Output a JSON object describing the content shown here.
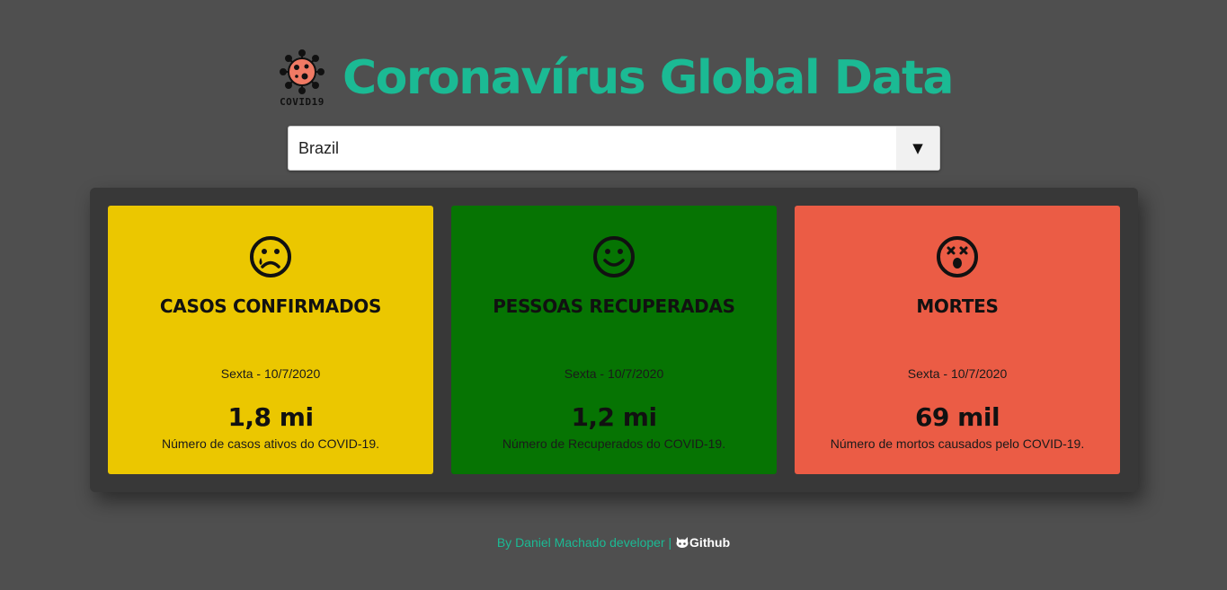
{
  "header": {
    "logo_text": "COVID19",
    "title": "Coronavírus Global Data"
  },
  "country_select": {
    "selected": "Brazil",
    "arrow": "▼"
  },
  "cards": [
    {
      "label": "CASOS CONFIRMADOS",
      "date": "Sexta - 10/7/2020",
      "value": "1,8 mi",
      "description": "Número de casos ativos do COVID-19.",
      "color": "#ebc700",
      "icon": "sad-face-icon"
    },
    {
      "label": "PESSOAS RECUPERADAS",
      "date": "Sexta - 10/7/2020",
      "value": "1,2 mi",
      "description": "Número de Recuperados do COVID-19.",
      "color": "#067403",
      "icon": "smile-face-icon"
    },
    {
      "label": "MORTES",
      "date": "Sexta - 10/7/2020",
      "value": "69 mil",
      "description": "Número de mortos causados pelo COVID-19.",
      "color": "#eb5c45",
      "icon": "dizzy-face-icon"
    }
  ],
  "footer": {
    "by_text": "By Daniel Machado developer | ",
    "github_label": "Github"
  }
}
